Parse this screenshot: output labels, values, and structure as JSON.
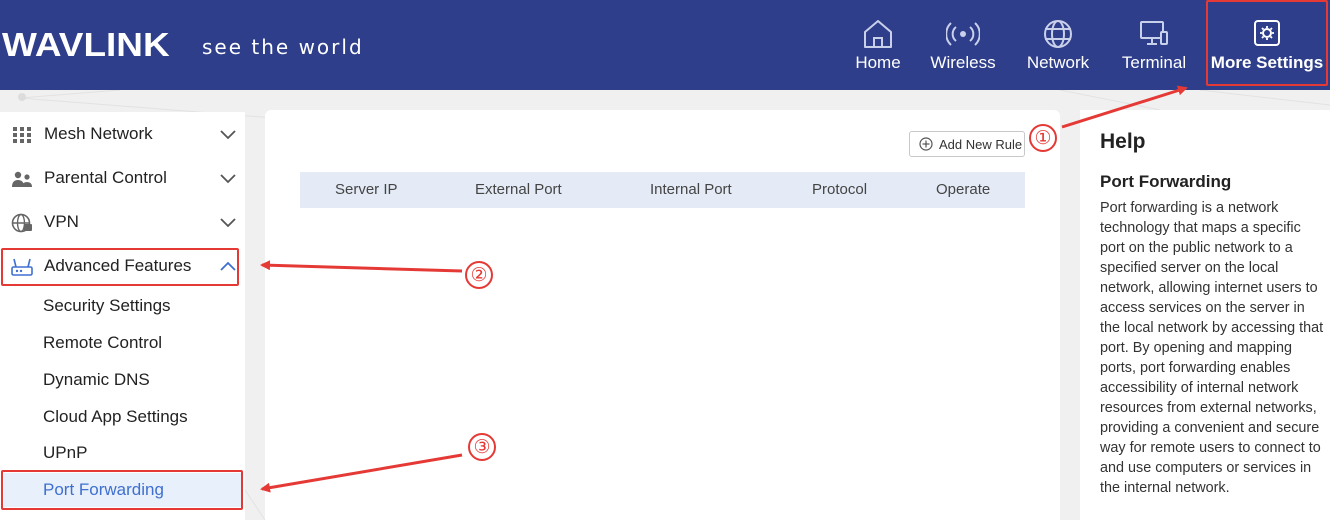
{
  "brand": {
    "name": "WAVLINK",
    "tagline": "see the world"
  },
  "nav": {
    "items": [
      {
        "label": "Home",
        "icon": "home-icon"
      },
      {
        "label": "Wireless",
        "icon": "wireless-icon"
      },
      {
        "label": "Network",
        "icon": "globe-icon"
      },
      {
        "label": "Terminal",
        "icon": "terminal-icon"
      },
      {
        "label": "More Settings",
        "icon": "settings-icon",
        "active": true
      }
    ]
  },
  "sidebar": {
    "groups": [
      {
        "label": "Mesh Network",
        "icon": "mesh-grid-icon",
        "expanded": false
      },
      {
        "label": "Parental Control",
        "icon": "parental-icon",
        "expanded": false
      },
      {
        "label": "VPN",
        "icon": "vpn-icon",
        "expanded": false
      },
      {
        "label": "Advanced Features",
        "icon": "advanced-features-icon",
        "expanded": true
      }
    ],
    "sub_items": [
      {
        "label": "Security Settings"
      },
      {
        "label": "Remote Control"
      },
      {
        "label": "Dynamic DNS"
      },
      {
        "label": "Cloud App Settings"
      },
      {
        "label": "UPnP"
      },
      {
        "label": "Port Forwarding",
        "active": true
      }
    ]
  },
  "main": {
    "add_button_label": "Add New Rule",
    "columns": [
      "Server IP",
      "External Port",
      "Internal Port",
      "Protocol",
      "Operate"
    ]
  },
  "help": {
    "title": "Help",
    "subtitle": "Port Forwarding",
    "body": "Port forwarding is a network technology that maps a specific port on the public network to a specified server on the local network, allowing internet users to access services on the server in the local network by accessing that port. By opening and mapping ports, port forwarding enables accessibility of internal network resources from external networks, providing a convenient and secure way for remote users to connect to and use computers or services in the internal network."
  },
  "annotations": {
    "step1": "①",
    "step2": "②",
    "step3": "③"
  },
  "colors": {
    "header_bg": "#2e3e8a",
    "accent": "#3f6fcf",
    "annotation": "#e53935",
    "table_head_bg": "#e4ebf6"
  }
}
